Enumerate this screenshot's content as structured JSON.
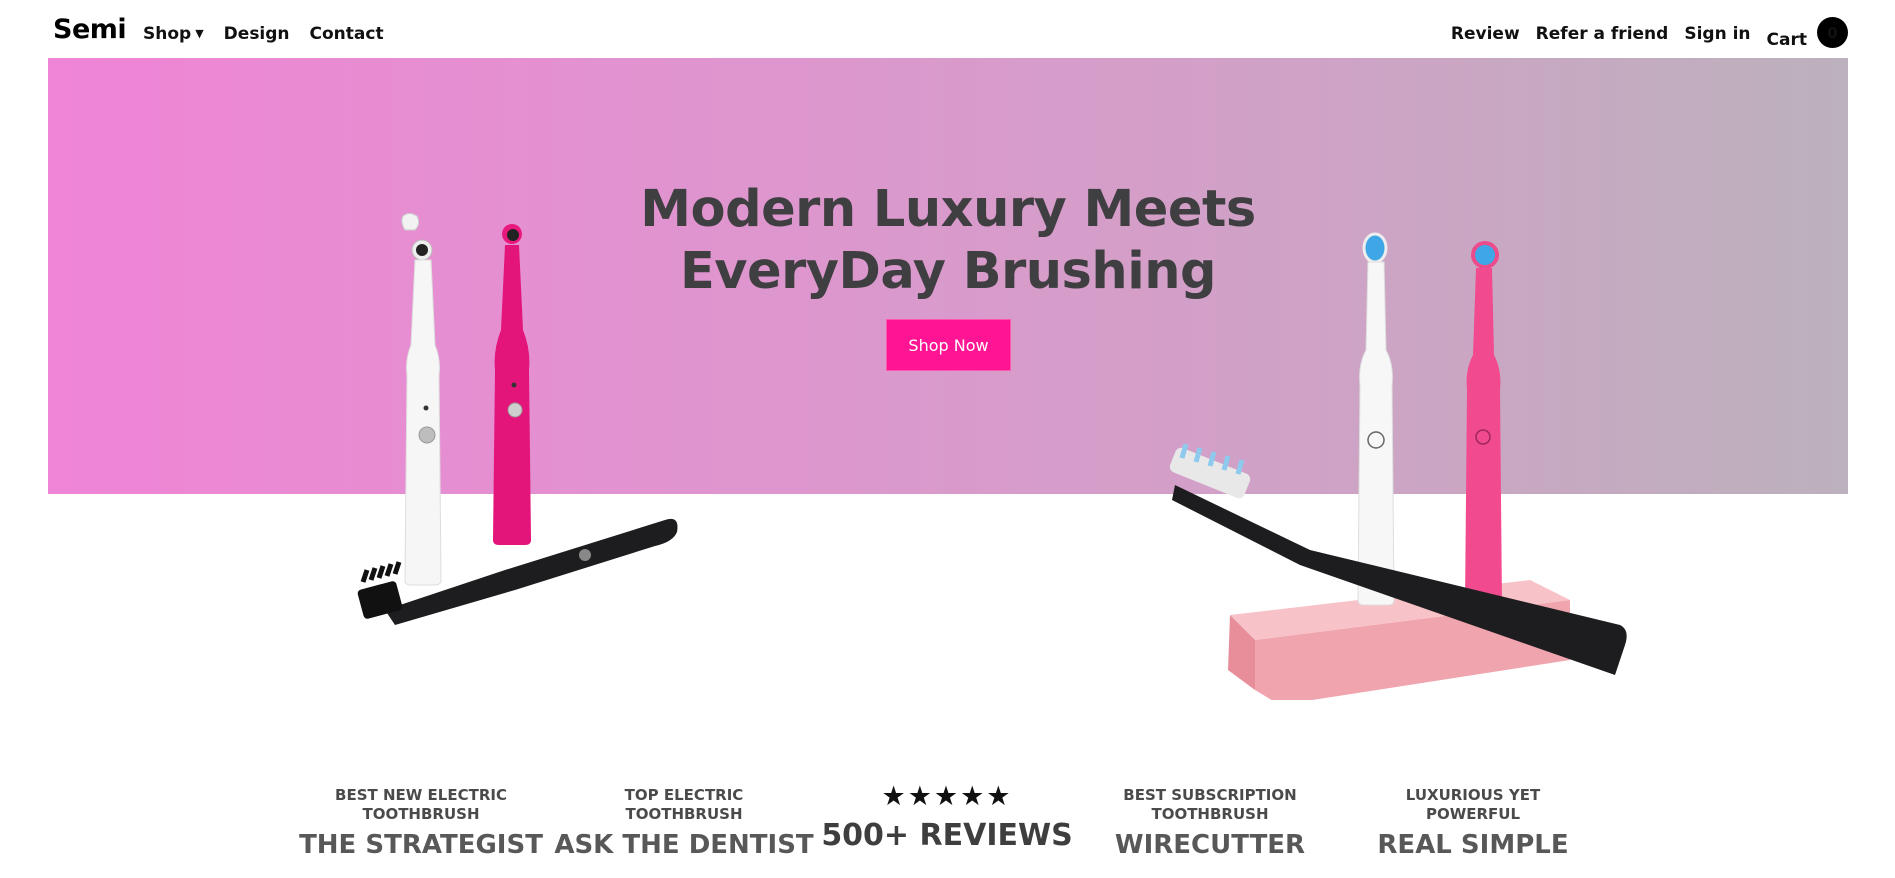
{
  "nav": {
    "logo": "Semi",
    "left_items": [
      {
        "label": "Shop",
        "has_dropdown": true
      },
      {
        "label": "Design"
      },
      {
        "label": "Contact"
      }
    ],
    "right_items": [
      {
        "label": "Review"
      },
      {
        "label": "Refer a friend"
      },
      {
        "label": "Sign in"
      }
    ],
    "cart": {
      "label": "Cart",
      "count": "0"
    }
  },
  "hero": {
    "title_line1": "Modern Luxury Meets",
    "title_line2": "EveryDay Brushing",
    "cta_label": "Shop Now",
    "gradient_colors": [
      "#f084d6",
      "#bcb1bc"
    ],
    "cta_color": "#ff1493"
  },
  "products": {
    "left_icon": "electric-toothbrush-set-black-white-pink",
    "right_icon": "electric-toothbrush-set-on-pink-stand"
  },
  "press": {
    "items": [
      {
        "sub_line1": "BEST NEW ELECTRIC",
        "sub_line2": "TOOTHBRUSH",
        "name": "THE STRATEGIST"
      },
      {
        "sub_line1": "TOP ELECTRIC",
        "sub_line2": "TOOTHBRUSH",
        "name": "ASK THE DENTIST"
      },
      {
        "stars": "★★★★★",
        "name": "500+ REVIEWS"
      },
      {
        "sub_line1": "BEST SUBSCRIPTION",
        "sub_line2": "TOOTHBRUSH",
        "name": "WIRECUTTER"
      },
      {
        "sub_line1": "LUXURIOUS YET",
        "sub_line2": "POWERFUL",
        "name": "REAL SIMPLE"
      }
    ]
  }
}
